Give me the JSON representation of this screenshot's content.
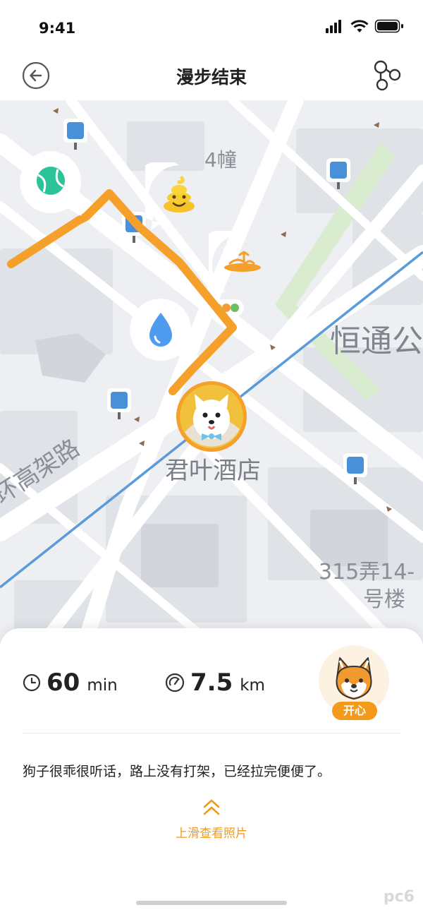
{
  "status_bar": {
    "time": "9:41"
  },
  "nav": {
    "title": "漫步结束",
    "back_icon": "back-arrow-icon",
    "route_icon": "route-icon"
  },
  "map": {
    "labels": {
      "building_4": "4幢",
      "hengtong": "恒通公",
      "hotel": "君叶酒店",
      "elevated_road": "环高架路",
      "building_315_line1": "315弄14-",
      "building_315_line2": "号楼"
    },
    "route_color": "#f5a02a",
    "markers": [
      "tennis-ball-icon",
      "poop-icon",
      "pee-puddle-icon",
      "water-drop-icon"
    ]
  },
  "stats": {
    "duration_value": "60",
    "duration_unit": "min",
    "distance_value": "7.5",
    "distance_unit": "km"
  },
  "mood": {
    "label": "开心",
    "icon": "shiba-dog-face-icon"
  },
  "note": "狗子很乖很听话，路上没有打架，已经拉完便便了。",
  "swipe_hint": "上滑查看照片",
  "watermark": "pc6",
  "accent_color": "#f39a1b"
}
